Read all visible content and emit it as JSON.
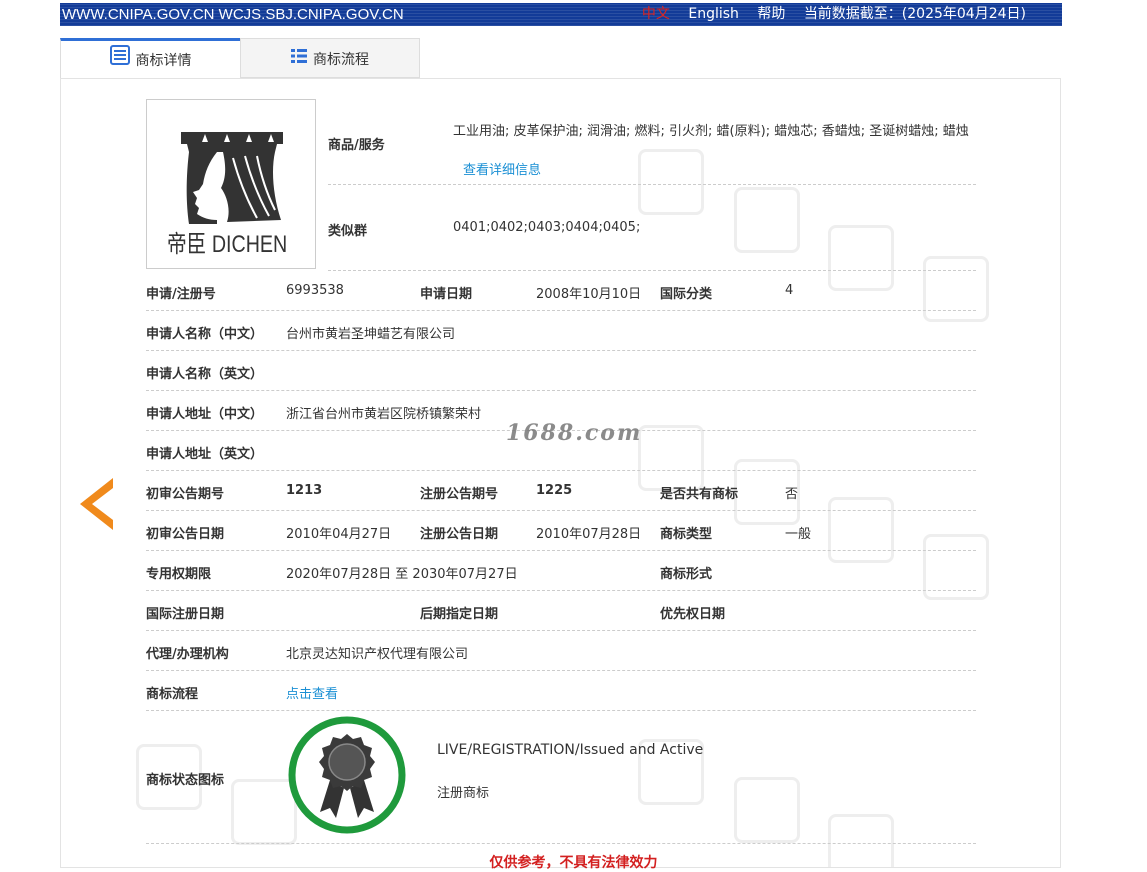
{
  "topbar": {
    "site": "WWW.CNIPA.GOV.CN WCJS.SBJ.CNIPA.GOV.CN",
    "lang_zh": "中文",
    "lang_en": "English",
    "help": "帮助",
    "data_as_of": "当前数据截至：(2025年04月24日)"
  },
  "tabs": [
    {
      "label": "商标详情"
    },
    {
      "label": "商标流程"
    }
  ],
  "logo": {
    "text": "帝臣 DICHEN"
  },
  "goods": {
    "label": "商品/服务",
    "text": "工业用油; 皮革保护油; 润滑油; 燃料; 引火剂; 蜡(原料); 蜡烛芯; 香蜡烛; 圣诞树蜡烛; 蜡烛",
    "more_link": "查看详细信息"
  },
  "similar_group": {
    "label": "类似群",
    "value": "0401;0402;0403;0404;0405;"
  },
  "fields": {
    "reg_no_label": "申请/注册号",
    "reg_no": "6993538",
    "app_date_label": "申请日期",
    "app_date": "2008年10月10日",
    "intl_class_label": "国际分类",
    "intl_class": "4",
    "applicant_cn_label": "申请人名称（中文）",
    "applicant_cn": "台州市黄岩圣坤蜡艺有限公司",
    "applicant_en_label": "申请人名称（英文）",
    "applicant_en": "",
    "address_cn_label": "申请人地址（中文）",
    "address_cn": "浙江省台州市黄岩区院桥镇繁荣村",
    "address_en_label": "申请人地址（英文）",
    "address_en": "",
    "prelim_issue_label": "初审公告期号",
    "prelim_issue": "1213",
    "reg_issue_label": "注册公告期号",
    "reg_issue": "1225",
    "shared_label": "是否共有商标",
    "shared": "否",
    "prelim_date_label": "初审公告日期",
    "prelim_date": "2010年04月27日",
    "reg_date_label": "注册公告日期",
    "reg_date": "2010年07月28日",
    "tm_type_label": "商标类型",
    "tm_type": "一般",
    "exclusive_label": "专用权期限",
    "exclusive": "2020年07月28日 至 2030年07月27日",
    "tm_form_label": "商标形式",
    "tm_form": "",
    "intl_reg_date_label": "国际注册日期",
    "intl_reg_date": "",
    "later_date_label": "后期指定日期",
    "later_date": "",
    "priority_date_label": "优先权日期",
    "priority_date": "",
    "agent_label": "代理/办理机构",
    "agent": "北京灵达知识产权代理有限公司",
    "process_label": "商标流程",
    "process_link": "点击查看",
    "status_icon_label": "商标状态图标",
    "status_en": "LIVE/REGISTRATION/Issued and Active",
    "status_cn": "注册商标"
  },
  "watermark_text": "1688.com",
  "disclaimer": "仅供参考，不具有法律效力",
  "colors": {
    "topbar": "#123b98",
    "link": "#1a8fd4",
    "arrow": "#f08a1c",
    "badge_ring": "#1f9a3c",
    "disclaimer": "#d32020"
  },
  "icons": {
    "tab_detail": "document-list-icon",
    "tab_process": "list-icon",
    "nav_prev": "chevron-left-icon",
    "status": "rosette-award-icon"
  }
}
